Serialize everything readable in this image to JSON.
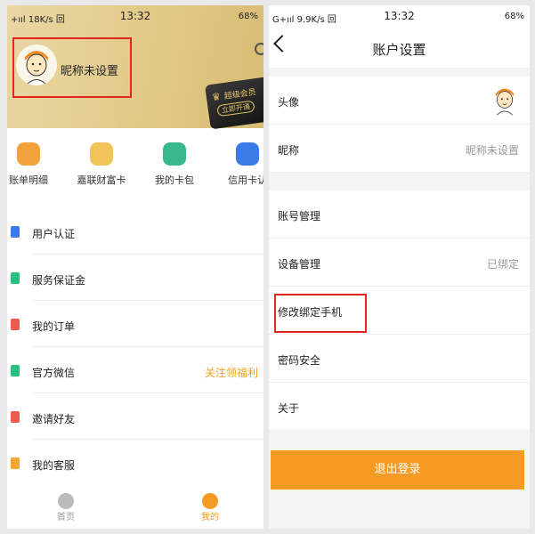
{
  "left": {
    "status": {
      "left": "+ııl 18K/s 回",
      "time": "13:32",
      "right": "68%"
    },
    "profile": {
      "nickname": "昵称未设置"
    },
    "vip": {
      "title": "超级会员",
      "action": "立即开通"
    },
    "quick": [
      {
        "label": "账单明细",
        "color": "#f2a23a"
      },
      {
        "label": "嘉联财富卡",
        "color": "#f0c35b"
      },
      {
        "label": "我的卡包",
        "color": "#39b88e"
      },
      {
        "label": "信用卡认",
        "color": "#3b7be8"
      }
    ],
    "menu": [
      {
        "label": "用户认证",
        "icon_color": "#3b7be8",
        "aux": ""
      },
      {
        "label": "服务保证金",
        "icon_color": "#2dbd7d",
        "aux": ""
      },
      {
        "label": "我的订单",
        "icon_color": "#ef5a4d",
        "aux": ""
      },
      {
        "label": "官方微信",
        "icon_color": "#2dbd7d",
        "aux": "关注领福利"
      },
      {
        "label": "邀请好友",
        "icon_color": "#ef5a4d",
        "aux": ""
      },
      {
        "label": "我的客服",
        "icon_color": "#f3a53a",
        "aux": ""
      }
    ],
    "tabs": [
      {
        "label": "首页",
        "active": false
      },
      {
        "label": "我的",
        "active": true
      }
    ]
  },
  "right": {
    "status": {
      "left": "G+ııl 9.9K/s 回",
      "time": "13:32",
      "right": "68%"
    },
    "title": "账户设置",
    "rows": [
      {
        "label": "头像",
        "value": ""
      },
      {
        "label": "昵称",
        "value": "昵称未设置"
      },
      {
        "label": "账号管理",
        "value": ""
      },
      {
        "label": "设备管理",
        "value": "已绑定"
      },
      {
        "label": "修改绑定手机",
        "value": ""
      },
      {
        "label": "密码安全",
        "value": ""
      },
      {
        "label": "关于",
        "value": ""
      }
    ],
    "logout": "退出登录"
  },
  "colors": {
    "accent": "#f59b23",
    "highlight": "#e1261c",
    "gold": "#e3cc8c"
  }
}
